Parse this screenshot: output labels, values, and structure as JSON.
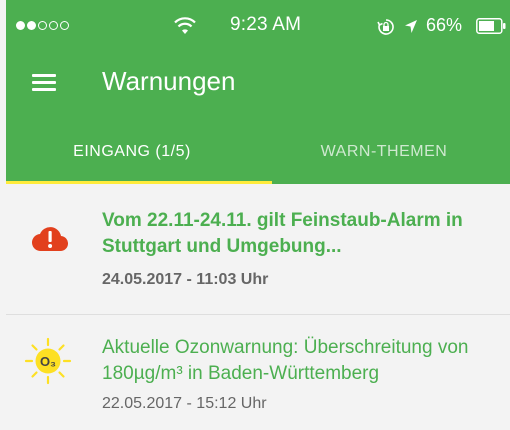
{
  "status_bar": {
    "time": "9:23 AM",
    "battery": "66%",
    "icons": [
      "signal-dots",
      "wifi-icon",
      "orientation-lock-icon",
      "location-arrow-icon",
      "battery-icon"
    ]
  },
  "toolbar": {
    "title": "Warnungen",
    "menu_icon": "hamburger-menu-icon"
  },
  "tabs": [
    {
      "label": "EINGANG (1/5)",
      "active": true
    },
    {
      "label": "WARN-THEMEN",
      "active": false
    }
  ],
  "messages": [
    {
      "icon": "cloud-alert-icon",
      "title": "Vom 22.11-24.11. gilt Feinstaub-Alarm in Stuttgart und Umgebung...",
      "date": "24.05.2017 - 11:03 Uhr",
      "unread": true
    },
    {
      "icon": "ozone-sun-icon",
      "icon_text": "O₃",
      "title": "Aktuelle Ozonwarnung: Überschreitung von 180µg/m³ in Baden-Württemberg",
      "date": "22.05.2017 - 15:12 Uhr",
      "unread": false
    }
  ],
  "colors": {
    "primary": "#4caf50",
    "indicator": "#ffeb3b",
    "alert": "#e2401d",
    "sun": "#fde023"
  }
}
